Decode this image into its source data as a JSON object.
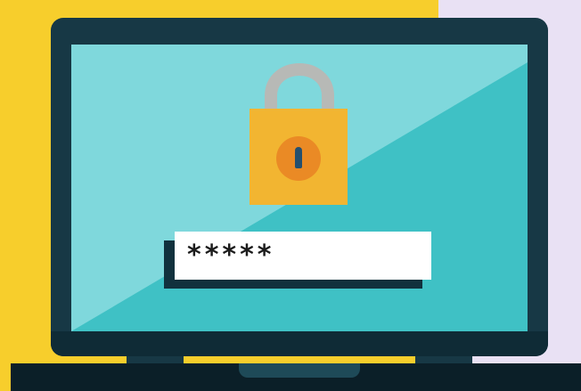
{
  "illustration": {
    "password_field": {
      "masked_text": "*****"
    }
  },
  "icons": {
    "padlock": "lock-icon",
    "keyhole": "keyhole-icon"
  },
  "colors": {
    "background_yellow": "#f7ce2c",
    "background_lavender": "#e9e1f4",
    "screen_teal": "#3fc1c5",
    "screen_light_teal": "#7fd8dc",
    "frame_dark": "#173845",
    "lock_body": "#f2b531",
    "lock_shackle": "#b7b9b6",
    "keyhole_orange": "#ea8a25"
  }
}
